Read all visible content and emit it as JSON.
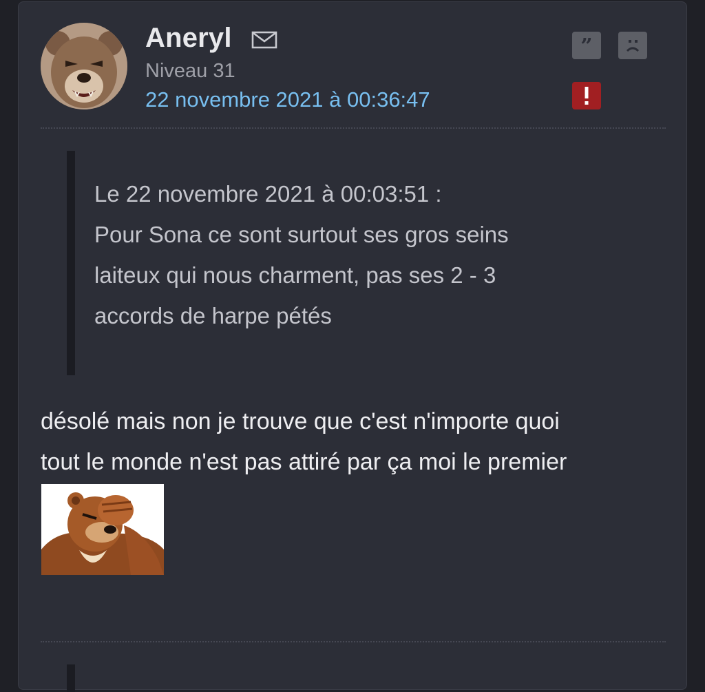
{
  "post": {
    "author": "Aneryl",
    "level": "Niveau 31",
    "date": "22 novembre 2021 à 00:36:47",
    "quote": {
      "header": "Le 22 novembre 2021 à 00:03:51 :",
      "lines": [
        "Pour Sona ce sont surtout ses gros seins",
        "laiteux qui nous charment, pas ses 2 - 3",
        "accords de harpe pétés"
      ]
    },
    "body_lines": [
      "désolé mais non je trouve que c'est n'importe quoi",
      "tout le monde n'est pas attiré par ça moi le premier"
    ]
  },
  "icons": {
    "mail": "mail-icon",
    "quote": "quote-icon",
    "sad": "sad-face-icon",
    "report": "exclamation-icon"
  },
  "colors": {
    "background": "#1f2026",
    "card": "#2c2e37",
    "date_link": "#78bff0",
    "report": "#a11f22",
    "action_gray": "#5d5f66"
  }
}
